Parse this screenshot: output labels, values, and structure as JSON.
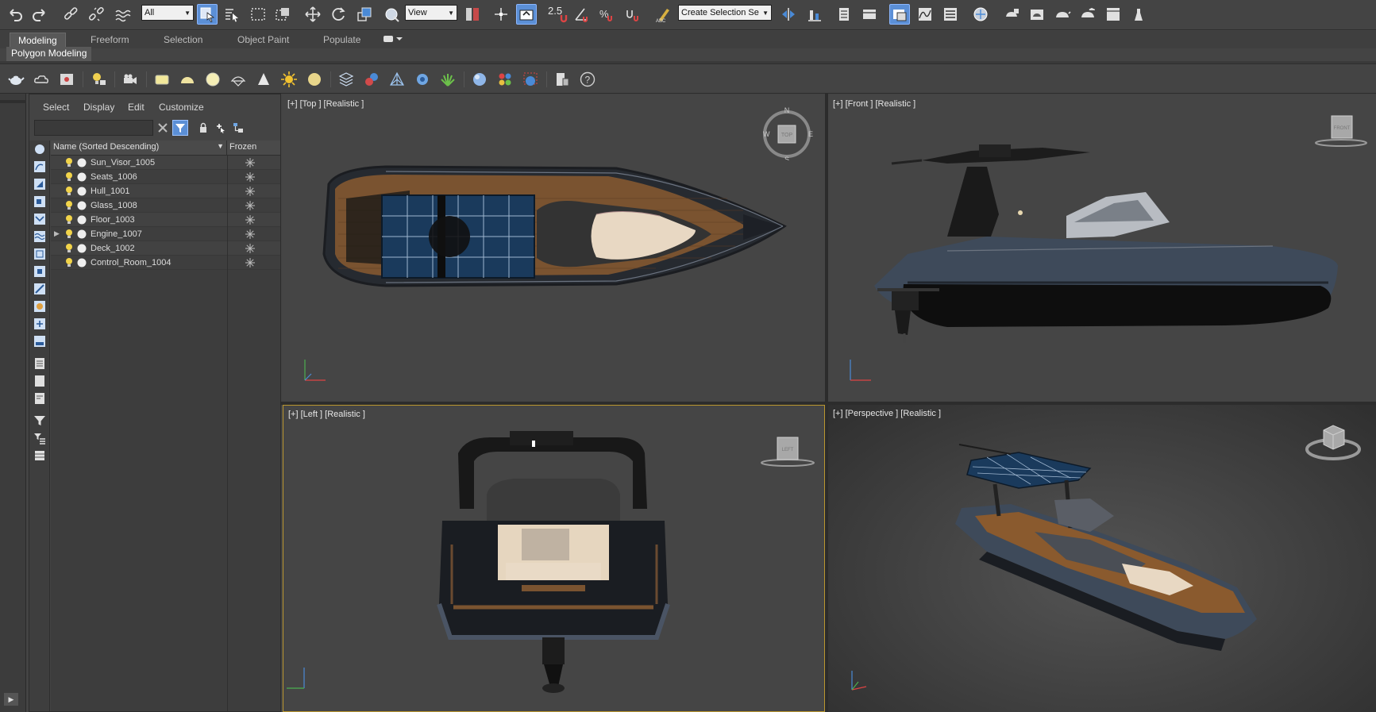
{
  "toolbar": {
    "selection_filter": "All",
    "ref_coord": "View",
    "snap_label": "2.5",
    "named_selection_placeholder": "Create Selection Se",
    "icons": [
      "undo-icon",
      "redo-icon",
      "link-icon",
      "unlink-icon",
      "bind-spacewarp-icon",
      "select-object-icon",
      "select-by-name-icon",
      "rect-region-icon",
      "window-crossing-icon",
      "move-icon",
      "rotate-icon",
      "scale-icon",
      "place-icon",
      "mirror-icon",
      "align-icon",
      "layer-explorer-icon",
      "toggle-ribbon-icon",
      "curve-editor-icon",
      "schematic-view-icon",
      "material-editor-icon",
      "render-setup-icon",
      "rendered-frame-icon",
      "render-icon",
      "render-cloud-icon",
      "teapot-icon"
    ]
  },
  "ribbon": {
    "tabs": [
      "Modeling",
      "Freeform",
      "Selection",
      "Object Paint",
      "Populate"
    ],
    "active_tab": "Modeling",
    "sub_tab": "Polygon Modeling"
  },
  "scene_explorer": {
    "menu": [
      "Select",
      "Display",
      "Edit",
      "Customize"
    ],
    "columns": {
      "name": "Name (Sorted Descending)",
      "frozen": "Frozen"
    },
    "objects": [
      {
        "name": "Sun_Visor_1005",
        "expandable": false
      },
      {
        "name": "Seats_1006",
        "expandable": false
      },
      {
        "name": "Hull_1001",
        "expandable": false
      },
      {
        "name": "Glass_1008",
        "expandable": false
      },
      {
        "name": "Floor_1003",
        "expandable": false
      },
      {
        "name": "Engine_1007",
        "expandable": true
      },
      {
        "name": "Deck_1002",
        "expandable": false
      },
      {
        "name": "Control_Room_1004",
        "expandable": false
      }
    ]
  },
  "viewports": {
    "top": {
      "label": "[+] [Top ] [Realistic ]",
      "cube": "TOP"
    },
    "front": {
      "label": "[+] [Front ] [Realistic ]",
      "cube": "FRONT"
    },
    "left": {
      "label": "[+] [Left ] [Realistic ]",
      "cube": "LEFT"
    },
    "perspective": {
      "label": "[+] [Perspective ] [Realistic ]"
    }
  },
  "colors": {
    "ui_bg": "#444444",
    "accent": "#5b8fd6",
    "active_viewport_border": "#b9962f",
    "hull": "#3e4a5a",
    "wood": "#8a5a2e"
  }
}
